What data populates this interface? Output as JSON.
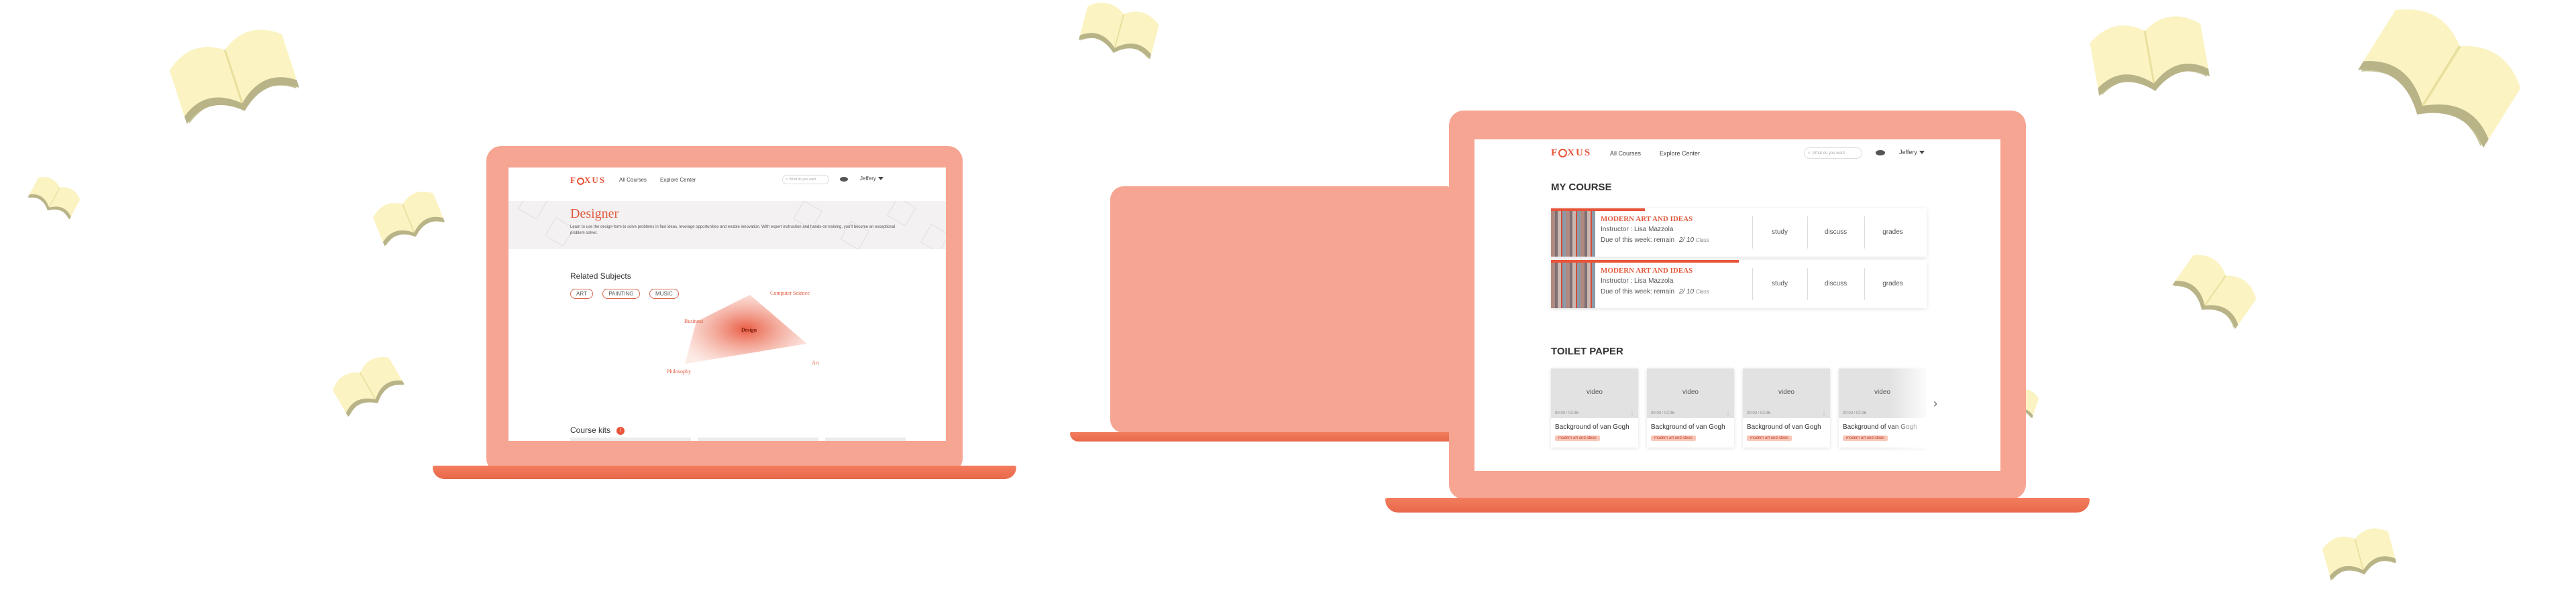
{
  "colors": {
    "accent": "#e8543a",
    "laptop": "#f6a592",
    "base": "#e8684a",
    "book": "#fbf3c2"
  },
  "left_screen": {
    "logo": {
      "pre": "F",
      "o": "O",
      "post": "XUS"
    },
    "nav": [
      "All Courses",
      "Explore Center"
    ],
    "search_placeholder": "What do you want",
    "user": "Jeffery",
    "hero": {
      "title": "Designer",
      "description": "Learn to use the design-form to solve problems in fast ideas, leverage opportunities and enable innovation. With expert instruction and hands-on training, you'll become an exceptional problem solver."
    },
    "related": {
      "heading": "Related Subjects",
      "tags": [
        "ART",
        "PAINTING",
        "MUSIC"
      ]
    },
    "radar": {
      "labels": {
        "top": "Computer Science",
        "left": "Business",
        "center": "Design",
        "right": "Art",
        "bottom": "Philosophy"
      }
    },
    "course_kits": {
      "heading": "Course kits",
      "badge": "!"
    }
  },
  "right_screen": {
    "logo": {
      "pre": "F",
      "o": "O",
      "post": "XUS"
    },
    "nav": [
      "All Courses",
      "Explore Center"
    ],
    "search_placeholder": "What do you want",
    "user": "Jeffery",
    "my_course": {
      "heading": "MY COURSE",
      "courses": [
        {
          "title": "MODERN ART AND IDEAS",
          "instructor": "Instructor : Lisa Mazzola",
          "remain_label": "Due of this week: remain",
          "remain_value": "2/ 10",
          "remain_unit": "Class",
          "actions": [
            "study",
            "discuss",
            "grades"
          ],
          "progress": 0.3
        },
        {
          "title": "MODERN ART AND IDEAS",
          "instructor": "Instructor : Lisa Mazzola",
          "remain_label": "Due of this week: remain",
          "remain_value": "2/ 10",
          "remain_unit": "Class",
          "actions": [
            "study",
            "discuss",
            "grades"
          ],
          "progress": 0.5
        }
      ]
    },
    "toilet_paper": {
      "heading": "TOILET PAPER",
      "videos": [
        {
          "label": "video",
          "time": "00:00 / 02:36",
          "title": "Background of van Gogh",
          "tag": "modern art and ideas"
        },
        {
          "label": "video",
          "time": "00:00 / 02:36",
          "title": "Background of van Gogh",
          "tag": "modern art and ideas"
        },
        {
          "label": "video",
          "time": "00:00 / 02:36",
          "title": "Background of van Gogh",
          "tag": "modern art and ideas"
        },
        {
          "label": "video",
          "time": "00:00 / 02:36",
          "title": "Background of van Gogh",
          "tag": "modern art and ideas"
        }
      ],
      "next": "›"
    }
  }
}
